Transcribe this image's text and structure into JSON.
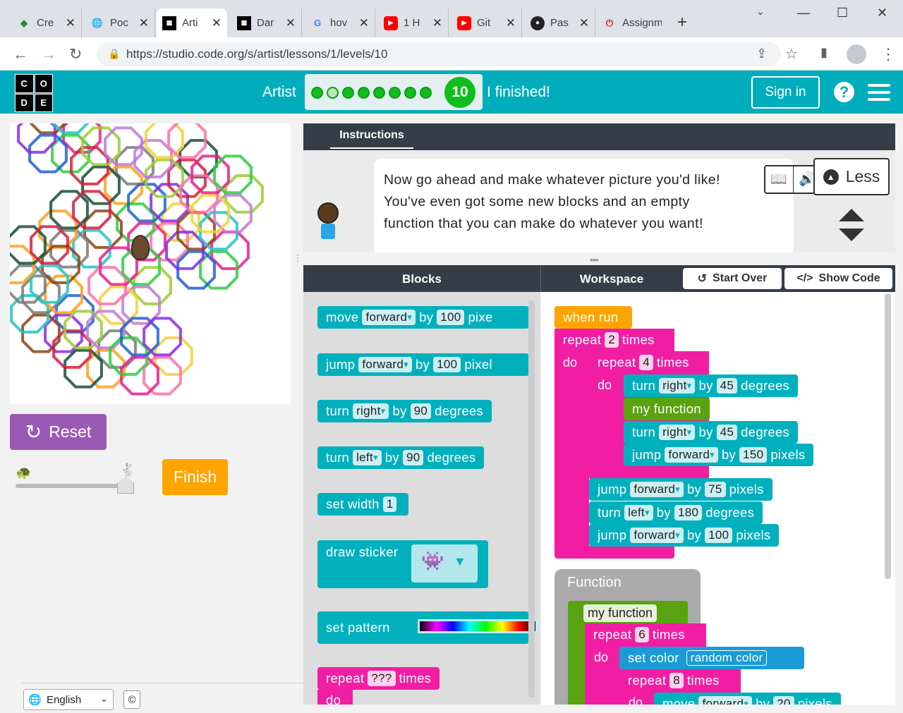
{
  "browser": {
    "tabs": [
      {
        "label": "Cre",
        "icon": "drive-icon"
      },
      {
        "label": "Poc",
        "icon": "globe-icon"
      },
      {
        "label": "Arti",
        "icon": "code-org-icon"
      },
      {
        "label": "Dar",
        "icon": "code-org-icon"
      },
      {
        "label": "hov",
        "icon": "google-icon"
      },
      {
        "label": "1 H",
        "icon": "youtube-icon"
      },
      {
        "label": "Git",
        "icon": "youtube-icon"
      },
      {
        "label": "Pas",
        "icon": "github-icon"
      },
      {
        "label": "Assignm",
        "icon": "power-icon"
      }
    ],
    "url": "https://studio.code.org/s/artist/lessons/1/levels/10"
  },
  "header": {
    "artist": "Artist",
    "level": "10",
    "finished": "I finished!",
    "signin": "Sign in",
    "logo_letters": [
      "C",
      "O",
      "D",
      "E"
    ]
  },
  "canvas": {
    "reset": "Reset",
    "finish": "Finish"
  },
  "instructions": {
    "tab": "Instructions",
    "text": "Now go ahead and make whatever picture you'd like! You've even got some new blocks and an empty function that you can make do whatever you want!",
    "less": "Less"
  },
  "workspace": {
    "blocks_title": "Blocks",
    "workspace_title": "Workspace",
    "start_over": "Start Over",
    "show_code": "Show Code"
  },
  "toolbox": {
    "b1": {
      "a": "move",
      "f": "forward",
      "b": "by",
      "v": "100",
      "c": "pixe"
    },
    "b2": {
      "a": "jump",
      "f": "forward",
      "b": "by",
      "v": "100",
      "c": "pixel"
    },
    "b3": {
      "a": "turn",
      "f": "right",
      "b": "by",
      "v": "90",
      "c": "degrees"
    },
    "b4": {
      "a": "turn",
      "f": "left",
      "b": "by",
      "v": "90",
      "c": "degrees"
    },
    "b5": {
      "a": "set width",
      "v": "1"
    },
    "b6": {
      "a": "draw sticker"
    },
    "b7": {
      "a": "set pattern"
    },
    "b8": {
      "a": "repeat",
      "v": "???",
      "c": "times",
      "d": "do"
    }
  },
  "program": {
    "when_run": "when run",
    "r1": {
      "a": "repeat",
      "v": "2",
      "c": "times",
      "d": "do"
    },
    "r2": {
      "a": "repeat",
      "v": "4",
      "c": "times",
      "d": "do"
    },
    "t1": {
      "a": "turn",
      "f": "right",
      "b": "by",
      "v": "45",
      "c": "degrees"
    },
    "mf": "my function",
    "t2": {
      "a": "turn",
      "f": "right",
      "b": "by",
      "v": "45",
      "c": "degrees"
    },
    "j1": {
      "a": "jump",
      "f": "forward",
      "b": "by",
      "v": "150",
      "c": "pixels"
    },
    "j2": {
      "a": "jump",
      "f": "forward",
      "b": "by",
      "v": "75",
      "c": "pixels"
    },
    "t3": {
      "a": "turn",
      "f": "left",
      "b": "by",
      "v": "180",
      "c": "degrees"
    },
    "j3": {
      "a": "jump",
      "f": "forward",
      "b": "by",
      "v": "100",
      "c": "pixels"
    },
    "function": "Function",
    "fname": "my function",
    "fr1": {
      "a": "repeat",
      "v": "6",
      "c": "times",
      "d": "do"
    },
    "sc": {
      "a": "set color",
      "c": "random color"
    },
    "fr2": {
      "a": "repeat",
      "v": "8",
      "c": "times",
      "d": "do"
    },
    "mv": {
      "a": "move",
      "f": "forward",
      "b": "by",
      "v": "20",
      "c": "pixels"
    }
  },
  "footer": {
    "language": "English",
    "copyright": "©"
  }
}
